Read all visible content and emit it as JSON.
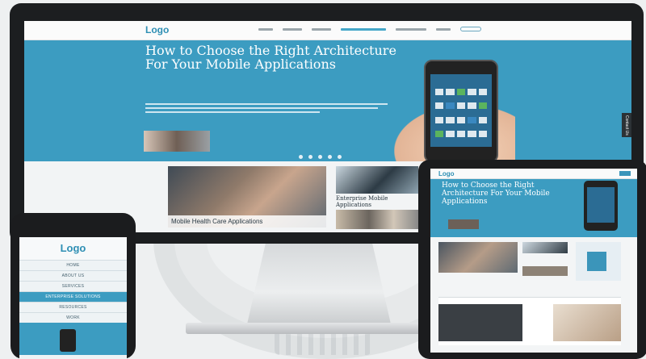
{
  "desktop": {
    "logo": "Logo",
    "hero_title": "How to Choose the Right Architecture For Your Mobile Applications",
    "contact_tab": "Contact Us",
    "featured_caption": "Mobile Health Care Applications",
    "side_title": "Enterprise Mobile Applications"
  },
  "tablet": {
    "logo": "Logo",
    "hero_title": "How to Choose the Right Architecture For Your Mobile Applications"
  },
  "phone": {
    "logo": "Logo",
    "menu": [
      "HOME",
      "ABOUT US",
      "SERVICES",
      "ENTERPRISE SOLUTIONS",
      "RESOURCES",
      "WORK"
    ],
    "active_index": 3
  },
  "colors": {
    "brand_blue": "#3c9cc1",
    "device_frame": "#1b1c1e"
  }
}
